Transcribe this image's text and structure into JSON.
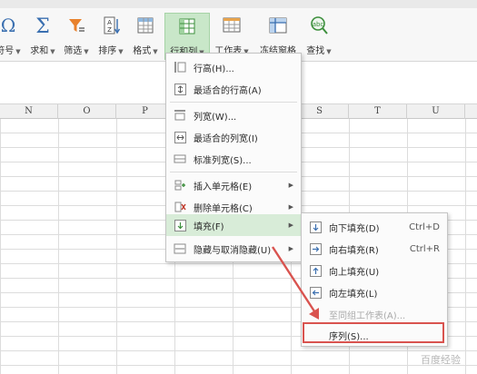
{
  "toolbar": {
    "buttons": [
      {
        "label": "符号",
        "icon": "omega-icon"
      },
      {
        "label": "求和",
        "icon": "sigma-icon"
      },
      {
        "label": "筛选",
        "icon": "funnel-icon"
      },
      {
        "label": "排序",
        "icon": "sort-az-icon"
      },
      {
        "label": "格式",
        "icon": "format-grid-icon"
      },
      {
        "label": "行和列",
        "icon": "row-col-icon",
        "active": true
      },
      {
        "label": "工作表",
        "icon": "worksheet-icon"
      },
      {
        "label": "冻结窗格",
        "icon": "freeze-pane-icon"
      },
      {
        "label": "查找",
        "icon": "find-magnifier-icon"
      }
    ],
    "active_color": "#c9e7c9"
  },
  "columns": [
    "N",
    "O",
    "P",
    "S",
    "T",
    "U"
  ],
  "row_col_menu": {
    "items": [
      {
        "label": "行高(H)...",
        "icon": "row-height-icon"
      },
      {
        "label": "最适合的行高(A)",
        "icon": "best-fit-row-icon"
      },
      {
        "label": "列宽(W)...",
        "icon": "column-width-icon"
      },
      {
        "label": "最适合的列宽(I)",
        "icon": "best-fit-column-icon"
      },
      {
        "label": "标准列宽(S)...",
        "icon": "standard-width-icon"
      },
      {
        "label": "插入单元格(E)",
        "icon": "insert-cells-icon"
      },
      {
        "label": "删除单元格(C)",
        "icon": "delete-cells-icon"
      },
      {
        "label": "填充(F)",
        "icon": "fill-icon"
      },
      {
        "label": "隐藏与取消隐藏(U)",
        "icon": "hide-unhide-icon"
      }
    ]
  },
  "fill_submenu": {
    "items": [
      {
        "label": "向下填充(D)",
        "shortcut": "Ctrl+D",
        "icon": "fill-down-icon"
      },
      {
        "label": "向右填充(R)",
        "shortcut": "Ctrl+R",
        "icon": "fill-right-icon"
      },
      {
        "label": "向上填充(U)",
        "icon": "fill-up-icon"
      },
      {
        "label": "向左填充(L)",
        "icon": "fill-left-icon"
      },
      {
        "label": "至同组工作表(A)...",
        "disabled": true
      },
      {
        "label": "序列(S)..."
      }
    ]
  },
  "watermark": "百度经验",
  "colors": {
    "highlight": "#d9534f",
    "menu_hover": "#d8ecd8"
  }
}
